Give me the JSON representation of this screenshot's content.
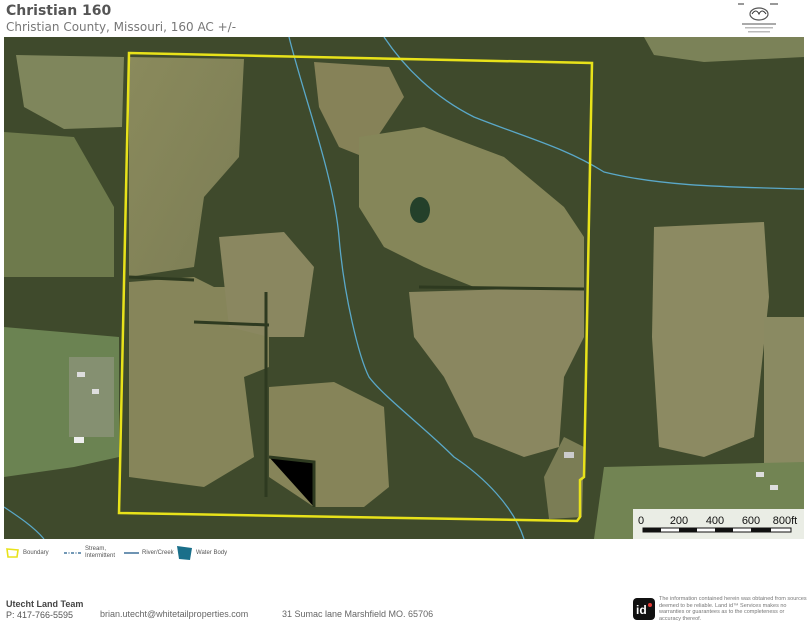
{
  "header": {
    "title": "Christian 160",
    "subtitle": "Christian County, Missouri, 160 AC +/-"
  },
  "map": {
    "type": "satellite-imagery",
    "boundary_color": "#e8e21a",
    "stream_color": "#5aa8c8",
    "scale": {
      "labels": [
        "0",
        "200",
        "400",
        "600",
        "800ft"
      ],
      "max_feet": 800
    }
  },
  "legend": {
    "items": [
      {
        "label": "Boundary",
        "icon": "boundary-icon",
        "color": "#e8e21a"
      },
      {
        "label": "Stream, Intermittent",
        "icon": "stream-icon",
        "color": "#1f5a8a"
      },
      {
        "label": "River/Creek",
        "icon": "river-icon",
        "color": "#1f5a8a"
      },
      {
        "label": "Water Body",
        "icon": "water-body-icon",
        "color": "#1a6f8a"
      }
    ]
  },
  "footer": {
    "team": "Utecht Land Team",
    "phone": "P: 417-766-5595",
    "email": "brian.utecht@whitetailproperties.com",
    "address": "31 Sumac lane Marshfield MO. 65706",
    "disclaimer": "The information contained herein was obtained from sources deemed to be reliable. Land id™ Services makes no warranties or guarantees as to the completeness or accuracy thereof."
  }
}
